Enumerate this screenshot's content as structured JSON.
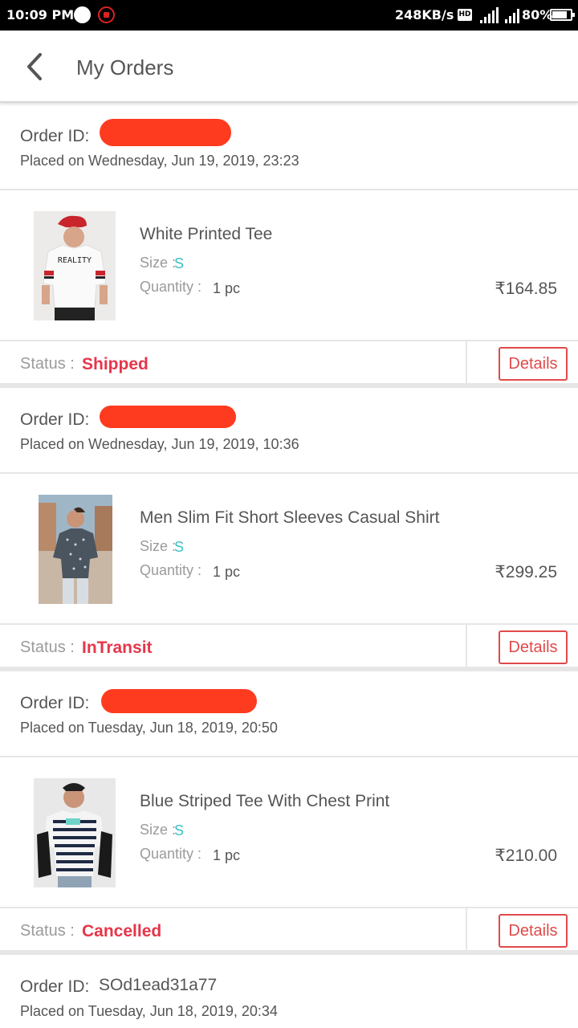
{
  "status_bar": {
    "time": "10:09 PM",
    "network_speed": "248KB/s",
    "hd_badge": "HD",
    "battery": "80%",
    "battery_level": 0.8,
    "icons": [
      "circle-icon",
      "youtube-icon",
      "hd-icon",
      "signal-icon",
      "signal-icon",
      "battery-icon"
    ]
  },
  "header": {
    "title": "My Orders",
    "back_icon": "chevron-left-icon"
  },
  "labels": {
    "order_id": "Order ID:",
    "size": "Size :",
    "quantity": "Quantity :",
    "status": "Status :",
    "details": "Details"
  },
  "orders": [
    {
      "order_id": "",
      "placed_on": "Placed on Wednesday, Jun 19, 2019, 23:23",
      "product": "White Printed Tee",
      "size": "S",
      "quantity": "1 pc",
      "price": "₹164.85",
      "status": "Shipped"
    },
    {
      "order_id": "",
      "placed_on": "Placed on Wednesday, Jun 19, 2019, 10:36",
      "product": "Men Slim Fit Short Sleeves Casual Shirt",
      "size": "S",
      "quantity": "1 pc",
      "price": "₹299.25",
      "status": "InTransit"
    },
    {
      "order_id": "",
      "placed_on": "Placed on Tuesday, Jun 18, 2019, 20:50",
      "product": "Blue Striped Tee With Chest Print",
      "size": "S",
      "quantity": "1 pc",
      "price": "₹210.00",
      "status": "Cancelled"
    },
    {
      "order_id": "SOd1ead31a77",
      "placed_on": "Placed on Tuesday, Jun 18, 2019, 20:34"
    }
  ],
  "colors": {
    "status_red": "#e6364a",
    "size_teal": "#3cc0c8",
    "redaction": "#ff3b1f",
    "details_border": "#e04a4a"
  }
}
